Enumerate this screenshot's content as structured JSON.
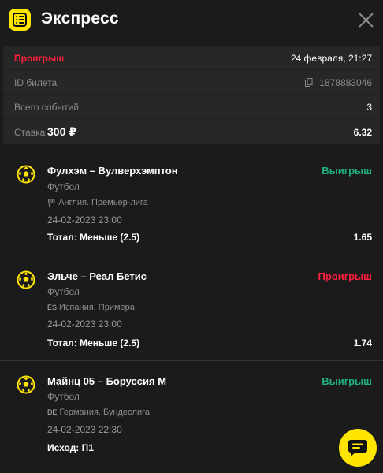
{
  "header": {
    "title": "Экспресс",
    "menu_icon": "list-icon",
    "close_icon": "close-icon"
  },
  "summary": {
    "status": "Проигрыш",
    "datetime": "24 февраля, 21:27",
    "ticket_label": "ID билета",
    "ticket_id": "1878883046",
    "events_label": "Всего событий",
    "events_count": "3",
    "stake_label": "Ставка",
    "stake_amount": "300 ₽",
    "total_odds": "6.32"
  },
  "events": [
    {
      "title": "Фулхэм – Вулверхэмптон",
      "result": "Выигрыш",
      "sport": "Футбол",
      "flag": "🏴",
      "league": "Англия. Премьер-лига",
      "date": "24-02-2023 23:00",
      "bet": "Тотал: Меньше (2.5)",
      "odds": "1.65"
    },
    {
      "title": "Эльче – Реал Бетис",
      "result": "Проигрыш",
      "sport": "Футбол",
      "flag": "ES",
      "league": "Испания. Примера",
      "date": "24-02-2023 23:00",
      "bet": "Тотал: Меньше (2.5)",
      "odds": "1.74"
    },
    {
      "title": "Майнц 05 – Боруссия М",
      "result": "Выигрыш",
      "sport": "Футбол",
      "flag": "DE",
      "league": "Германия. Бундеслига",
      "date": "24-02-2023 22:30",
      "bet": "Исход: П1",
      "odds": ""
    }
  ],
  "colors": {
    "accent": "#ffe500",
    "won": "#21b07b",
    "lost": "#ff1f3d",
    "background": "#1b1b1b",
    "card": "#272727"
  },
  "chat_icon": "chat-icon"
}
